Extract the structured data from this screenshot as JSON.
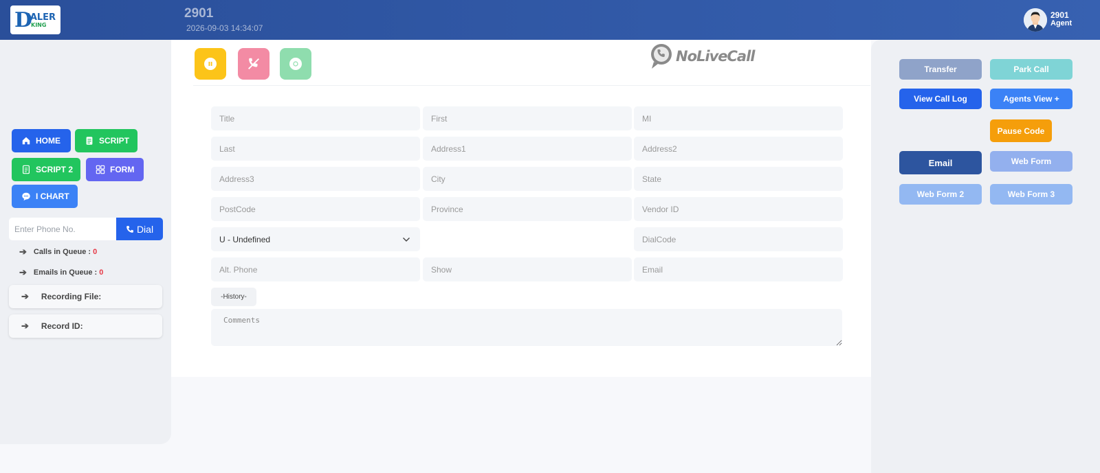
{
  "header": {
    "logo_text": "IALER",
    "logo_sub": "KING",
    "agent_number": "2901",
    "datetime": "2026-09-03 14:34:07",
    "user_name": "2901",
    "user_role": "Agent"
  },
  "sidebar": {
    "nav": {
      "home": "HOME",
      "script": "SCRIPT",
      "script2": "SCRIPT 2",
      "form": "FORM",
      "ichart": "I CHART"
    },
    "phone_placeholder": "Enter Phone No.",
    "dial_label": "Dial",
    "calls_queue_label": "Calls in Queue :",
    "calls_queue_count": "0",
    "emails_queue_label": "Emails in Queue :",
    "emails_queue_count": "0",
    "recording_label": "Recording File:",
    "record_id_label": "Record ID:"
  },
  "main": {
    "brand": "NoLiveCall",
    "fields": {
      "title": "Title",
      "first": "First",
      "mi": "MI",
      "last": "Last",
      "address1": "Address1",
      "address2": "Address2",
      "address3": "Address3",
      "city": "City",
      "state": "State",
      "postcode": "PostCode",
      "province": "Province",
      "vendor_id": "Vendor ID",
      "dialcode": "DialCode",
      "alt_phone": "Alt. Phone",
      "show": "Show",
      "email": "Email",
      "comments": "Comments"
    },
    "gender_selected": "U - Undefined",
    "history_label": "-History-"
  },
  "right": {
    "transfer": "Transfer",
    "park_call": "Park Call",
    "view_call_log": "View Call Log",
    "agents_view": "Agents View +",
    "pause_code": "Pause Code",
    "email": "Email",
    "web_form": "Web Form",
    "web_form_2": "Web Form 2",
    "web_form_3": "Web Form 3"
  },
  "colors": {
    "header": "#3761b1",
    "primary_blue": "#2563eb",
    "green": "#22c55e",
    "purple": "#6366f1",
    "pause_yellow": "#fcc419",
    "hangup_pink": "#f38ba4",
    "record_green": "#8fddae",
    "pause_code_orange": "#f59e0b",
    "queue_count": "#e63946"
  }
}
